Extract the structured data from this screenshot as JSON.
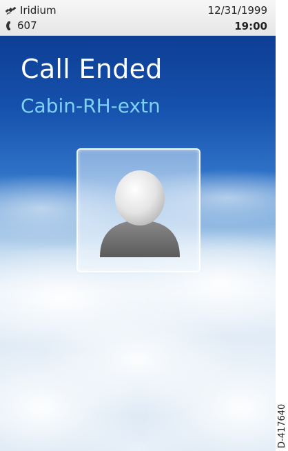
{
  "status_bar": {
    "network_name": "Iridium",
    "extension": "607",
    "date": "12/31/1999",
    "time": "19:00",
    "network_icon": "satellite-icon",
    "phone_icon": "phone-handset-icon"
  },
  "call": {
    "state": "Call Ended",
    "contact_name": "Cabin-RH-extn",
    "avatar_icon": "contact-silhouette-icon"
  },
  "figure_id": "D-417640",
  "colors": {
    "title_text": "#ffffff",
    "contact_text": "#7fd1f2",
    "sky_top": "#0d3e94"
  }
}
